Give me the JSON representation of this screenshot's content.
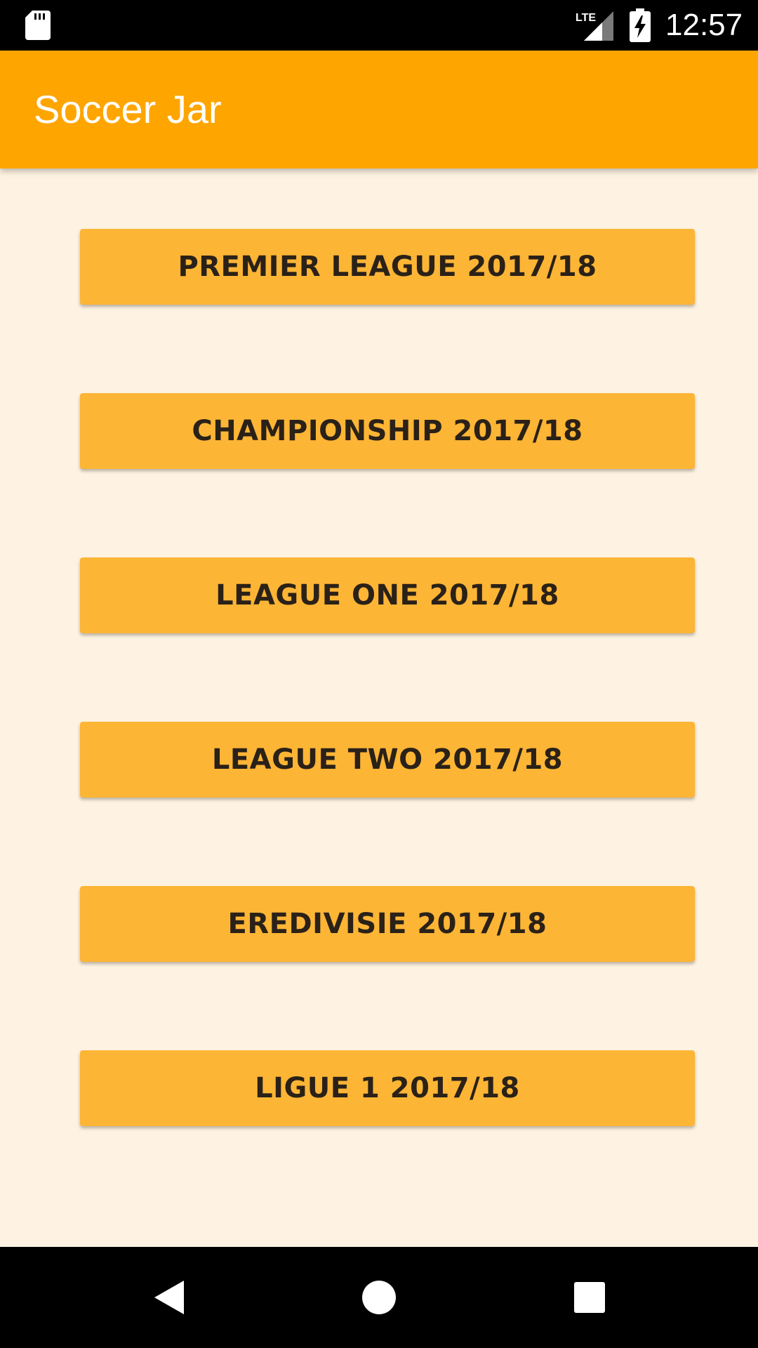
{
  "status_bar": {
    "time": "12:57",
    "network_label": "LTE",
    "icons": [
      "sd-card-icon",
      "lte-signal-icon",
      "battery-charging-icon"
    ]
  },
  "app_bar": {
    "title": "Soccer Jar"
  },
  "leagues": [
    {
      "label": "PREMIER LEAGUE 2017/18"
    },
    {
      "label": "CHAMPIONSHIP 2017/18"
    },
    {
      "label": "LEAGUE ONE 2017/18"
    },
    {
      "label": "LEAGUE TWO 2017/18"
    },
    {
      "label": "EREDIVISIE 2017/18"
    },
    {
      "label": "LIGUE 1 2017/18"
    }
  ],
  "nav_bar": {
    "icons": [
      "back-icon",
      "home-icon",
      "recents-icon"
    ]
  },
  "colors": {
    "app_bar": "#FFA500",
    "button": "#FDB535",
    "background": "#FEF3E2",
    "button_text": "#2A2118"
  }
}
